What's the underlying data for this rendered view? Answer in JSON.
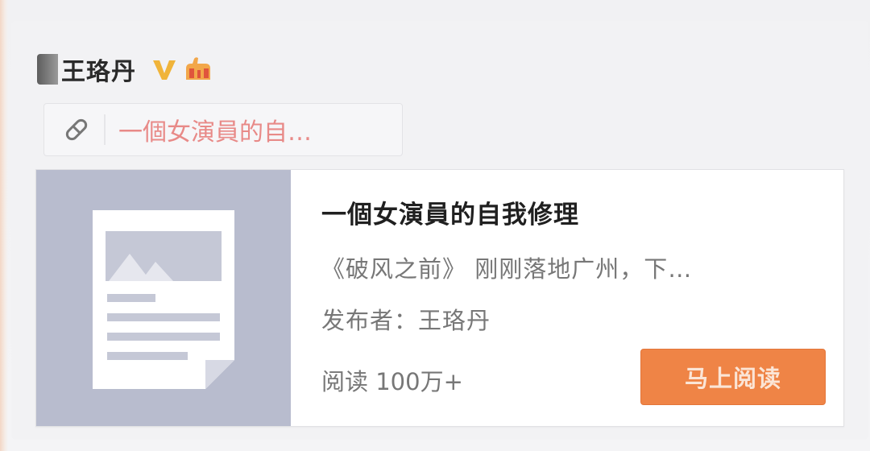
{
  "user": {
    "name": "王珞丹",
    "verified_badge_icon": "verified-v-icon",
    "extra_badge_icon": "hand-icon"
  },
  "link_pill": {
    "icon": "link-icon",
    "text": "一個女演員的自…"
  },
  "article": {
    "thumbnail_icon": "document-image-icon",
    "title": "一個女演員的自我修理",
    "excerpt": "《破风之前》 刚刚落地广州，下…",
    "publisher": "发布者：王珞丹",
    "reads": "阅读 100万+",
    "read_button_label": "马上阅读"
  },
  "colors": {
    "background": "#f3f3f5",
    "link_text": "#e88a88",
    "button": "#ef8446",
    "badge": "#f0b43a",
    "thumbnail": "#b8bcce"
  }
}
